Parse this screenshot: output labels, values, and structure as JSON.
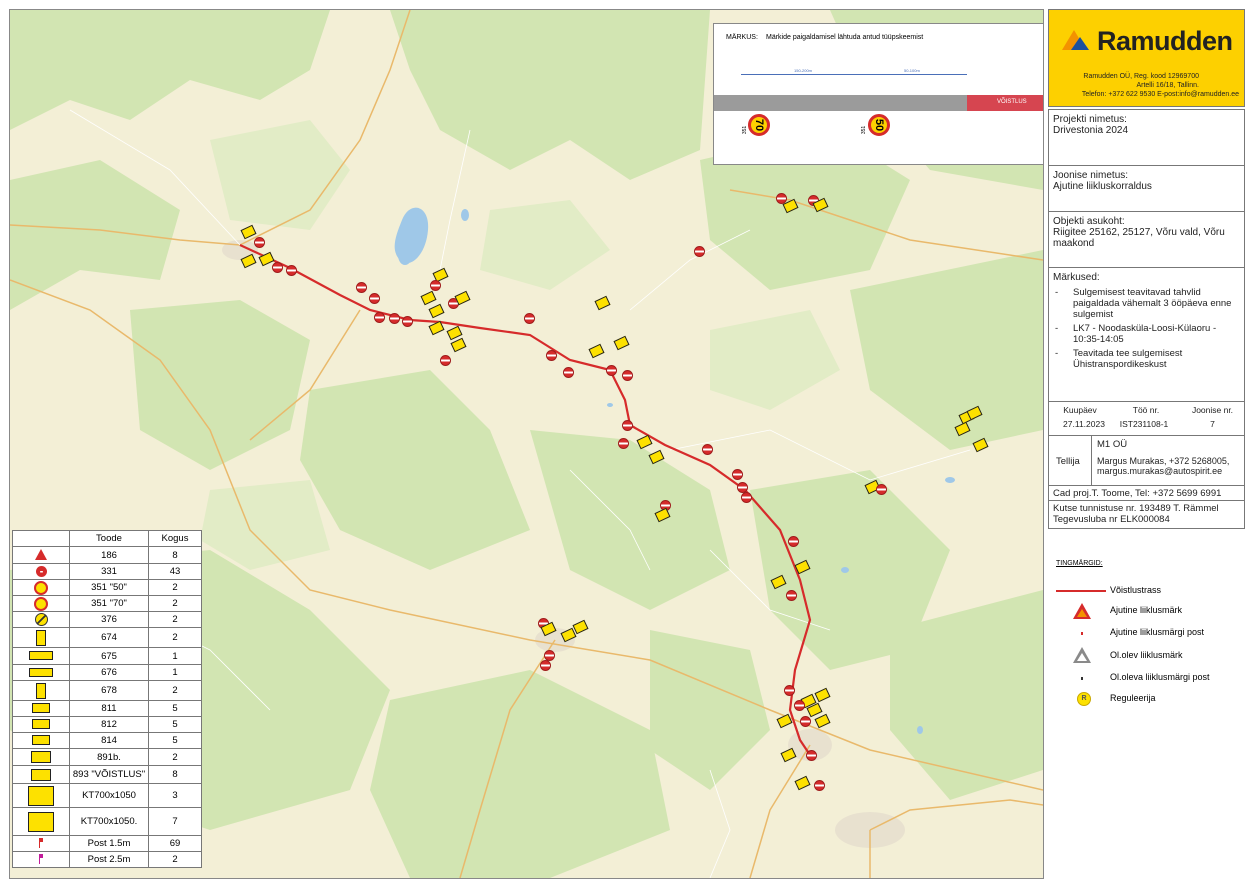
{
  "company": {
    "name": "Ramudden",
    "line1": "Ramudden OÜ, Reg. kood 12969700",
    "line2": "Artelli 16/18, Tallinn.",
    "line3": "Telefon: +372 622 9530 E-post:info@ramudden.ee"
  },
  "project": {
    "label": "Projekti nimetus:",
    "value": "Drivestonia 2024"
  },
  "drawing": {
    "label": "Joonise nimetus:",
    "value": "Ajutine liikluskorraldus"
  },
  "location": {
    "label": "Objekti asukoht:",
    "value": "Riigitee 25162, 25127, Võru vald, Võru maakond"
  },
  "notes": {
    "label": "Märkused:",
    "items": [
      "Sulgemisest teavitavad tahvlid paigaldada vähemalt 3 ööpäeva enne sulgemist",
      "LK7 - Noodasküla-Loosi-Külaoru - 10:35-14:05",
      "Teavitada tee sulgemisest Ühistranspordikeskust"
    ]
  },
  "meta": {
    "date_label": "Kuupäev",
    "date": "27.11.2023",
    "job_label": "Töö nr.",
    "job": "IST231108-1",
    "sheet_label": "Joonise nr.",
    "sheet": "7"
  },
  "client": {
    "label": "Tellija",
    "name": "M1 OÜ",
    "contact": "Margus Murakas, +372 5268005, margus.murakas@autospirit.ee"
  },
  "cad": "Cad proj.T. Toome, Tel: +372 5699 6991",
  "license": {
    "line1": "Kutse tunnistuse nr. 193489 T. Rämmel",
    "line2": "Tegevusluba nr ELK000084"
  },
  "legend": {
    "title": "TINGMÄRGID:",
    "items": [
      {
        "key": "race-route",
        "label": "Võistlustrass"
      },
      {
        "key": "temp-sign",
        "label": "Ajutine liiklusmärk"
      },
      {
        "key": "temp-post",
        "label": "Ajutine liiklusmärgi post"
      },
      {
        "key": "exist-sign",
        "label": "Ol.olev liiklusmärk"
      },
      {
        "key": "exist-post",
        "label": "Ol.oleva liiklusmärgi post"
      },
      {
        "key": "marshal",
        "label": "Reguleerija"
      }
    ]
  },
  "note_box": {
    "label": "MÄRKUS:",
    "text": "Märkide paigaldamisel lähtuda antud tüüpskeemist",
    "dim1": "150-200m",
    "dim2": "50-100m",
    "race_label": "VÕISTLUS",
    "sign1": "70",
    "sign2": "50",
    "post1": "351",
    "post2": "351"
  },
  "table": {
    "headers": [
      "Toode",
      "Kogus"
    ],
    "rows": [
      {
        "icon": "warning-triangle",
        "product": "186",
        "qty": "8"
      },
      {
        "icon": "no-entry",
        "product": "331",
        "qty": "43"
      },
      {
        "icon": "speed-50",
        "product": "351 \"50\"",
        "qty": "2"
      },
      {
        "icon": "speed-70",
        "product": "351 \"70\"",
        "qty": "2"
      },
      {
        "icon": "end-restriction",
        "product": "376",
        "qty": "2"
      },
      {
        "icon": "arrow-up-panel",
        "product": "674",
        "qty": "2"
      },
      {
        "icon": "arrow-right-panel",
        "product": "675",
        "qty": "1"
      },
      {
        "icon": "arrow-left-panel",
        "product": "676",
        "qty": "1"
      },
      {
        "icon": "turn-panel",
        "product": "678",
        "qty": "2"
      },
      {
        "icon": "plate",
        "product": "811",
        "qty": "5"
      },
      {
        "icon": "plate",
        "product": "812",
        "qty": "5"
      },
      {
        "icon": "plate",
        "product": "814",
        "qty": "5"
      },
      {
        "icon": "plate-text",
        "product": "891b.",
        "qty": "2"
      },
      {
        "icon": "plate-text",
        "product": "893 \"VÕISTLUS\"",
        "qty": "8"
      },
      {
        "icon": "board",
        "product": "KT700x1050",
        "qty": "3"
      },
      {
        "icon": "board",
        "product": "KT700x1050.",
        "qty": "7"
      },
      {
        "icon": "post-red",
        "product": "Post 1.5m",
        "qty": "69"
      },
      {
        "icon": "post-pink",
        "product": "Post 2.5m",
        "qty": "2"
      }
    ]
  },
  "colors": {
    "brand_yellow": "#fdd000",
    "route_red": "#d62b2b",
    "forest_green": "#cfe3b0",
    "field_yellow": "#f6edbd",
    "water_blue": "#9fc8e8"
  }
}
